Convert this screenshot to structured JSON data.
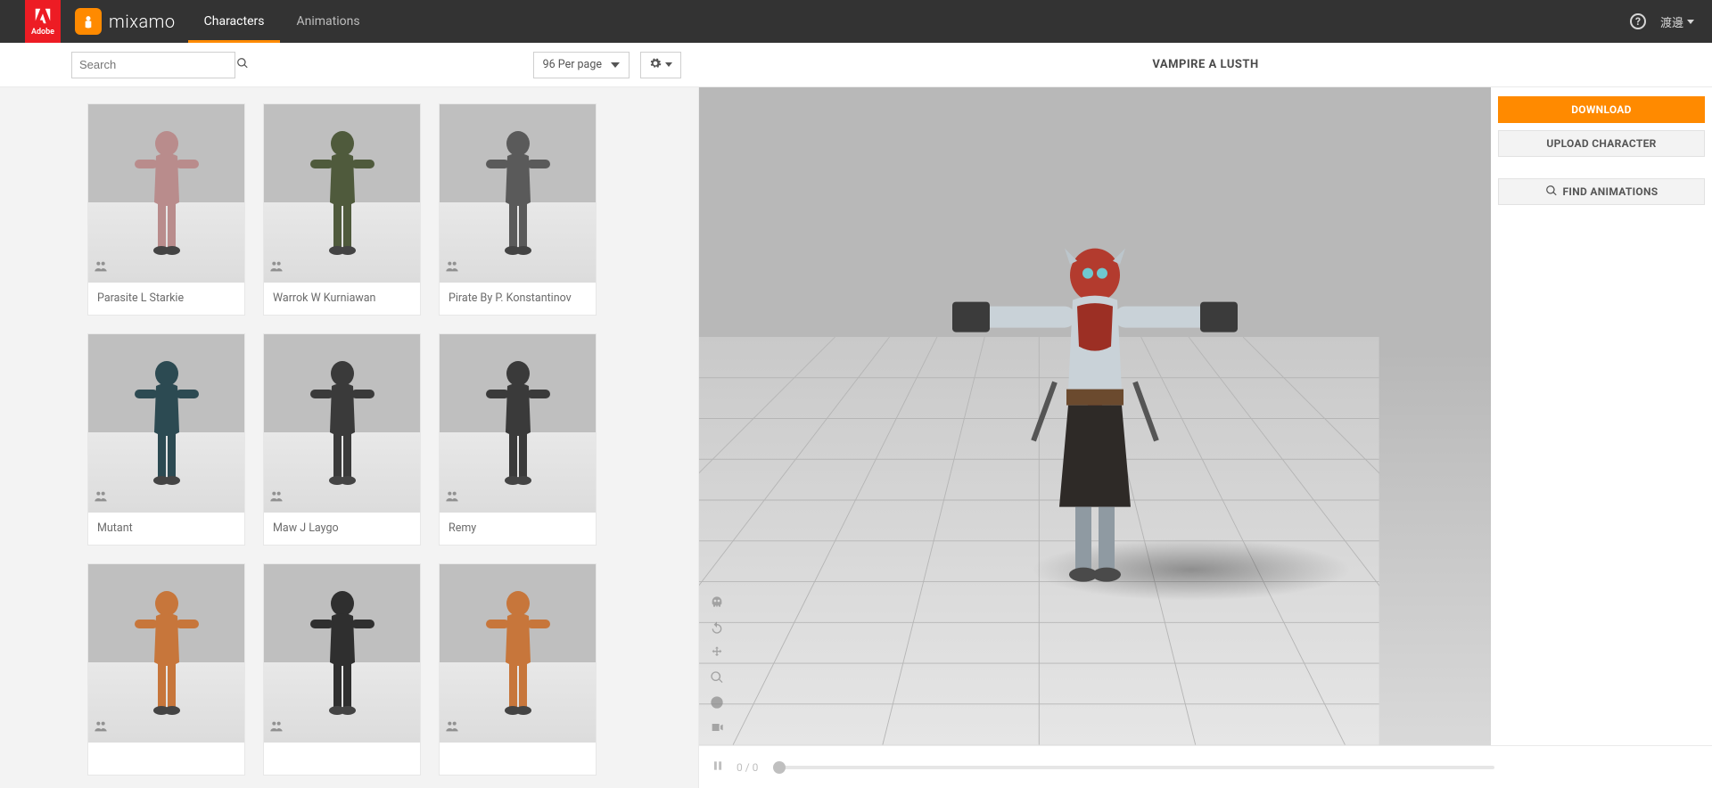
{
  "header": {
    "brand": "mixamo",
    "adobe_label": "Adobe",
    "tabs": {
      "characters": "Characters",
      "animations": "Animations"
    },
    "active_tab": "characters",
    "user_name": "渡邊"
  },
  "toolbar": {
    "search_placeholder": "Search",
    "perpage_label": "96 Per page",
    "selected_title": "VAMPIRE A LUSTH"
  },
  "characters": [
    {
      "name": "Parasite L Starkie",
      "color": "#b98c8c"
    },
    {
      "name": "Warrok W Kurniawan",
      "color": "#4f5a3c"
    },
    {
      "name": "Pirate By P. Konstantinov",
      "color": "#5a5a5a"
    },
    {
      "name": "Mutant",
      "color": "#2c4a52"
    },
    {
      "name": "Maw J Laygo",
      "color": "#3a3a3a"
    },
    {
      "name": "Remy",
      "color": "#3a3a3a"
    },
    {
      "name": "",
      "color": "#c7763b"
    },
    {
      "name": "",
      "color": "#2f2f2f"
    },
    {
      "name": "",
      "color": "#c7763b"
    }
  ],
  "actions": {
    "download": "DOWNLOAD",
    "upload": "UPLOAD CHARACTER",
    "find": "FIND ANIMATIONS"
  },
  "playback": {
    "current": "0",
    "total": "0"
  }
}
